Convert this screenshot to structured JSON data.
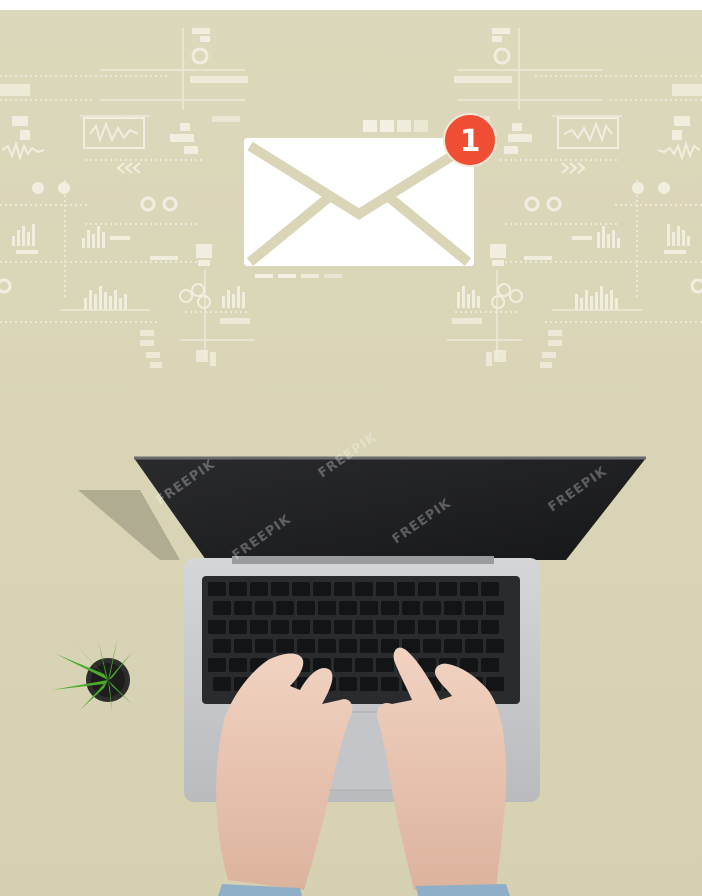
{
  "notification": {
    "count": "1"
  },
  "watermark": {
    "text": "FREEPIK"
  },
  "icons": {
    "mail": "mail-envelope-icon",
    "notification": "notification-badge-icon"
  },
  "colors": {
    "background": "#d9d5b6",
    "badge": "#ef4d34",
    "envelope": "#ffffff",
    "laptop_body": "#c7c9cc",
    "screen": "#1e1f21",
    "plant": "#4caa2c",
    "sleeve": "#8faec8"
  }
}
